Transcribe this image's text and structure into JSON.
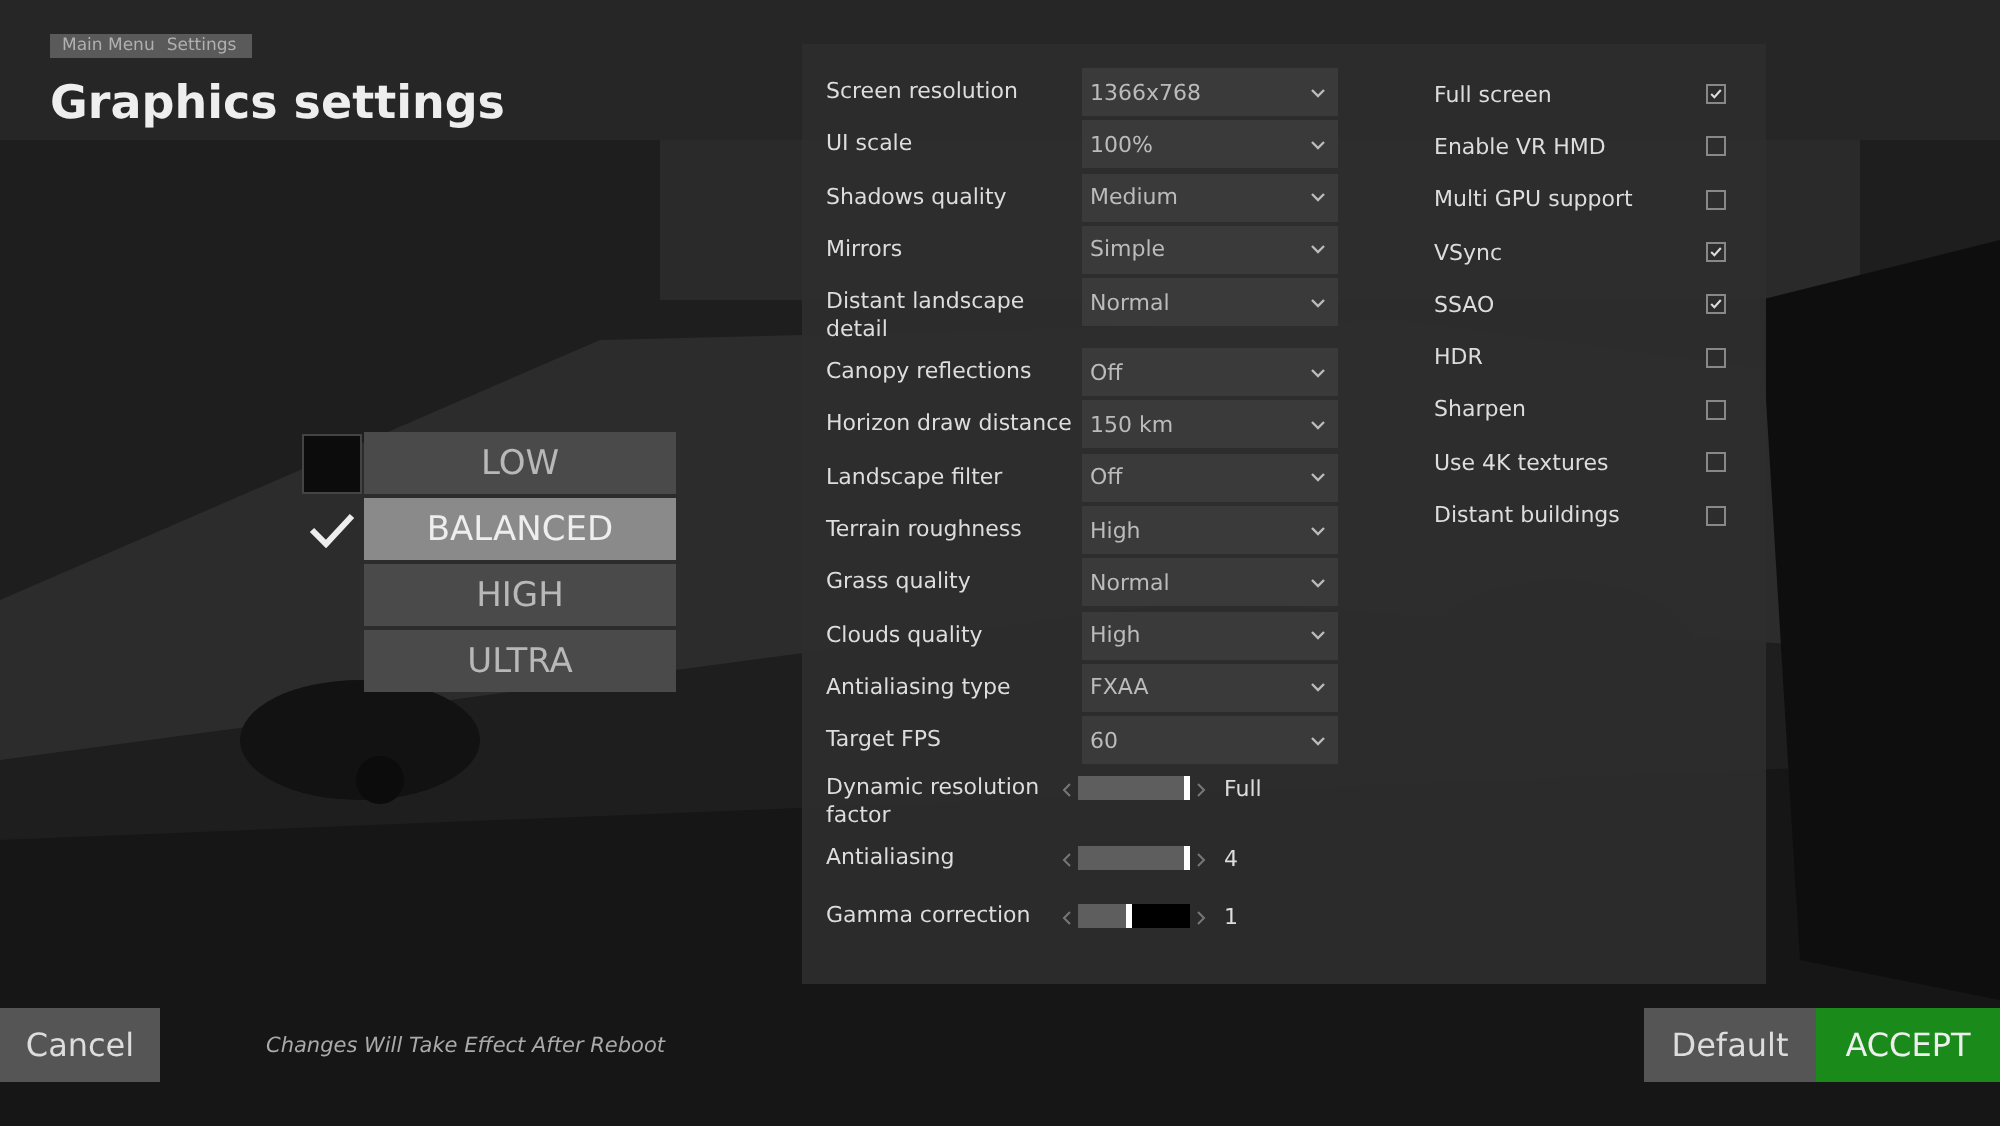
{
  "breadcrumb": [
    "Main Menu",
    "Settings"
  ],
  "title": "Graphics settings",
  "presets": [
    {
      "label": "LOW",
      "selected": false,
      "hovered": true
    },
    {
      "label": "BALANCED",
      "selected": true,
      "hovered": false
    },
    {
      "label": "HIGH",
      "selected": false,
      "hovered": false
    },
    {
      "label": "ULTRA",
      "selected": false,
      "hovered": false
    }
  ],
  "settings": [
    {
      "kind": "dropdown",
      "label": "Screen resolution",
      "value": "1366x768"
    },
    {
      "kind": "dropdown",
      "label": "UI scale",
      "value": "100%"
    },
    {
      "kind": "dropdown",
      "label": "Shadows quality",
      "value": "Medium"
    },
    {
      "kind": "dropdown",
      "label": "Mirrors",
      "value": "Simple"
    },
    {
      "kind": "dropdown",
      "label": "Distant landscape detail",
      "value": "Normal"
    },
    {
      "kind": "dropdown",
      "label": "Canopy reflections",
      "value": "Off"
    },
    {
      "kind": "dropdown",
      "label": "Horizon draw distance",
      "value": "150 km"
    },
    {
      "kind": "dropdown",
      "label": "Landscape filter",
      "value": "Off"
    },
    {
      "kind": "dropdown",
      "label": "Terrain roughness",
      "value": "High"
    },
    {
      "kind": "dropdown",
      "label": "Grass quality",
      "value": "Normal"
    },
    {
      "kind": "dropdown",
      "label": "Clouds quality",
      "value": "High"
    },
    {
      "kind": "dropdown",
      "label": "Antialiasing type",
      "value": "FXAA"
    },
    {
      "kind": "dropdown",
      "label": "Target FPS",
      "value": "60"
    },
    {
      "kind": "slider",
      "label": "Dynamic resolution factor",
      "level": 1.0,
      "reading": "Full"
    },
    {
      "kind": "slider",
      "label": "Antialiasing",
      "level": 1.0,
      "reading": "4"
    },
    {
      "kind": "slider",
      "label": "Gamma correction",
      "level": 0.48,
      "reading": "1"
    }
  ],
  "toggles": [
    {
      "label": "Full screen",
      "checked": true
    },
    {
      "label": "Enable VR HMD",
      "checked": false
    },
    {
      "label": "Multi GPU support",
      "checked": false
    },
    {
      "label": "VSync",
      "checked": true
    },
    {
      "label": "SSAO",
      "checked": true
    },
    {
      "label": "HDR",
      "checked": false
    },
    {
      "label": "Sharpen",
      "checked": false
    },
    {
      "label": "Use 4K textures",
      "checked": false
    },
    {
      "label": "Distant buildings",
      "checked": false
    }
  ],
  "footer": {
    "cancel": "Cancel",
    "note": "Changes Will Take Effect After Reboot",
    "default": "Default",
    "accept": "ACCEPT"
  }
}
